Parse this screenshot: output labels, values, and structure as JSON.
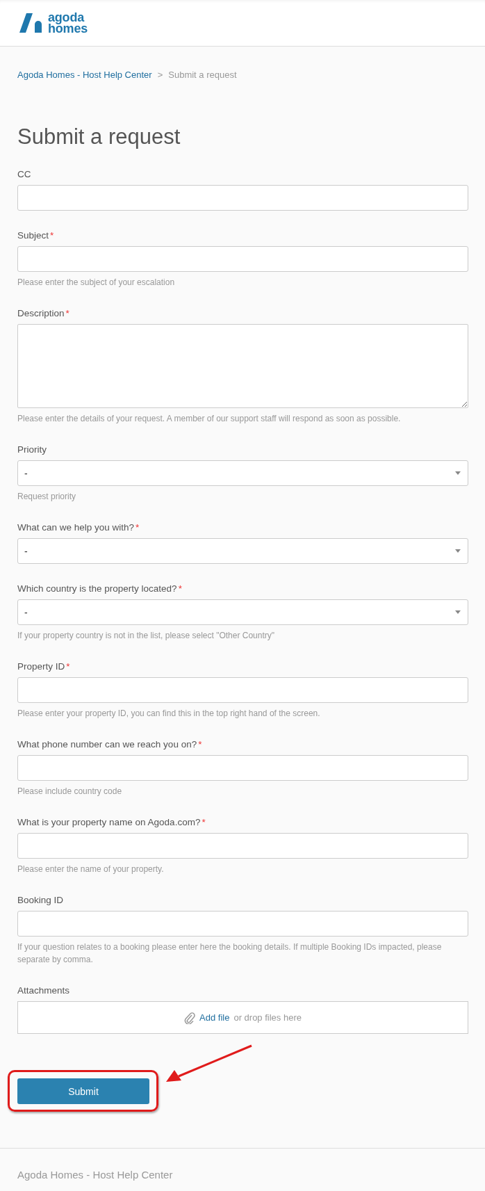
{
  "logo": {
    "line1": "agoda",
    "line2": "homes"
  },
  "breadcrumb": [
    {
      "label": "Agoda Homes - Host Help Center",
      "kind": "link"
    },
    {
      "label": "Submit a request",
      "kind": "current"
    }
  ],
  "breadcrumb_separator": ">",
  "title": "Submit a request",
  "required_marker": "*",
  "fields": [
    {
      "kind": "text",
      "label": "CC",
      "required": false
    },
    {
      "kind": "text",
      "label": "Subject",
      "required": true,
      "hint": "Please enter the subject of your escalation"
    },
    {
      "kind": "textarea",
      "label": "Description",
      "required": true,
      "hint": "Please enter the details of your request. A member of our support staff will respond as soon as possible."
    },
    {
      "kind": "select",
      "label": "Priority",
      "required": false,
      "value": "-",
      "hint": "Request priority"
    },
    {
      "kind": "select",
      "label": "What can we help you with?",
      "required": true,
      "value": "-"
    },
    {
      "kind": "select",
      "label": "Which country is the property located?",
      "required": true,
      "value": "-",
      "hint": "If your property country is not in the list, please select \"Other Country\""
    },
    {
      "kind": "text",
      "label": "Property ID",
      "required": true,
      "hint": "Please enter your property ID, you can find this in the top right hand of the screen."
    },
    {
      "kind": "text",
      "label": "What phone number can we reach you on?",
      "required": true,
      "hint": "Please include country code"
    },
    {
      "kind": "text",
      "label": "What is your property name on Agoda.com?",
      "required": true,
      "hint": "Please enter the name of your property."
    },
    {
      "kind": "text",
      "label": "Booking ID",
      "required": false,
      "hint": "If your question relates to a booking please enter here the booking details. If multiple Booking IDs impacted, please separate by comma."
    },
    {
      "kind": "attachment",
      "label": "Attachments",
      "link": "Add file",
      "text": "or drop files here"
    }
  ],
  "submit": {
    "label": "Submit",
    "highlighted": true
  },
  "footer": "Agoda Homes - Host Help Center"
}
